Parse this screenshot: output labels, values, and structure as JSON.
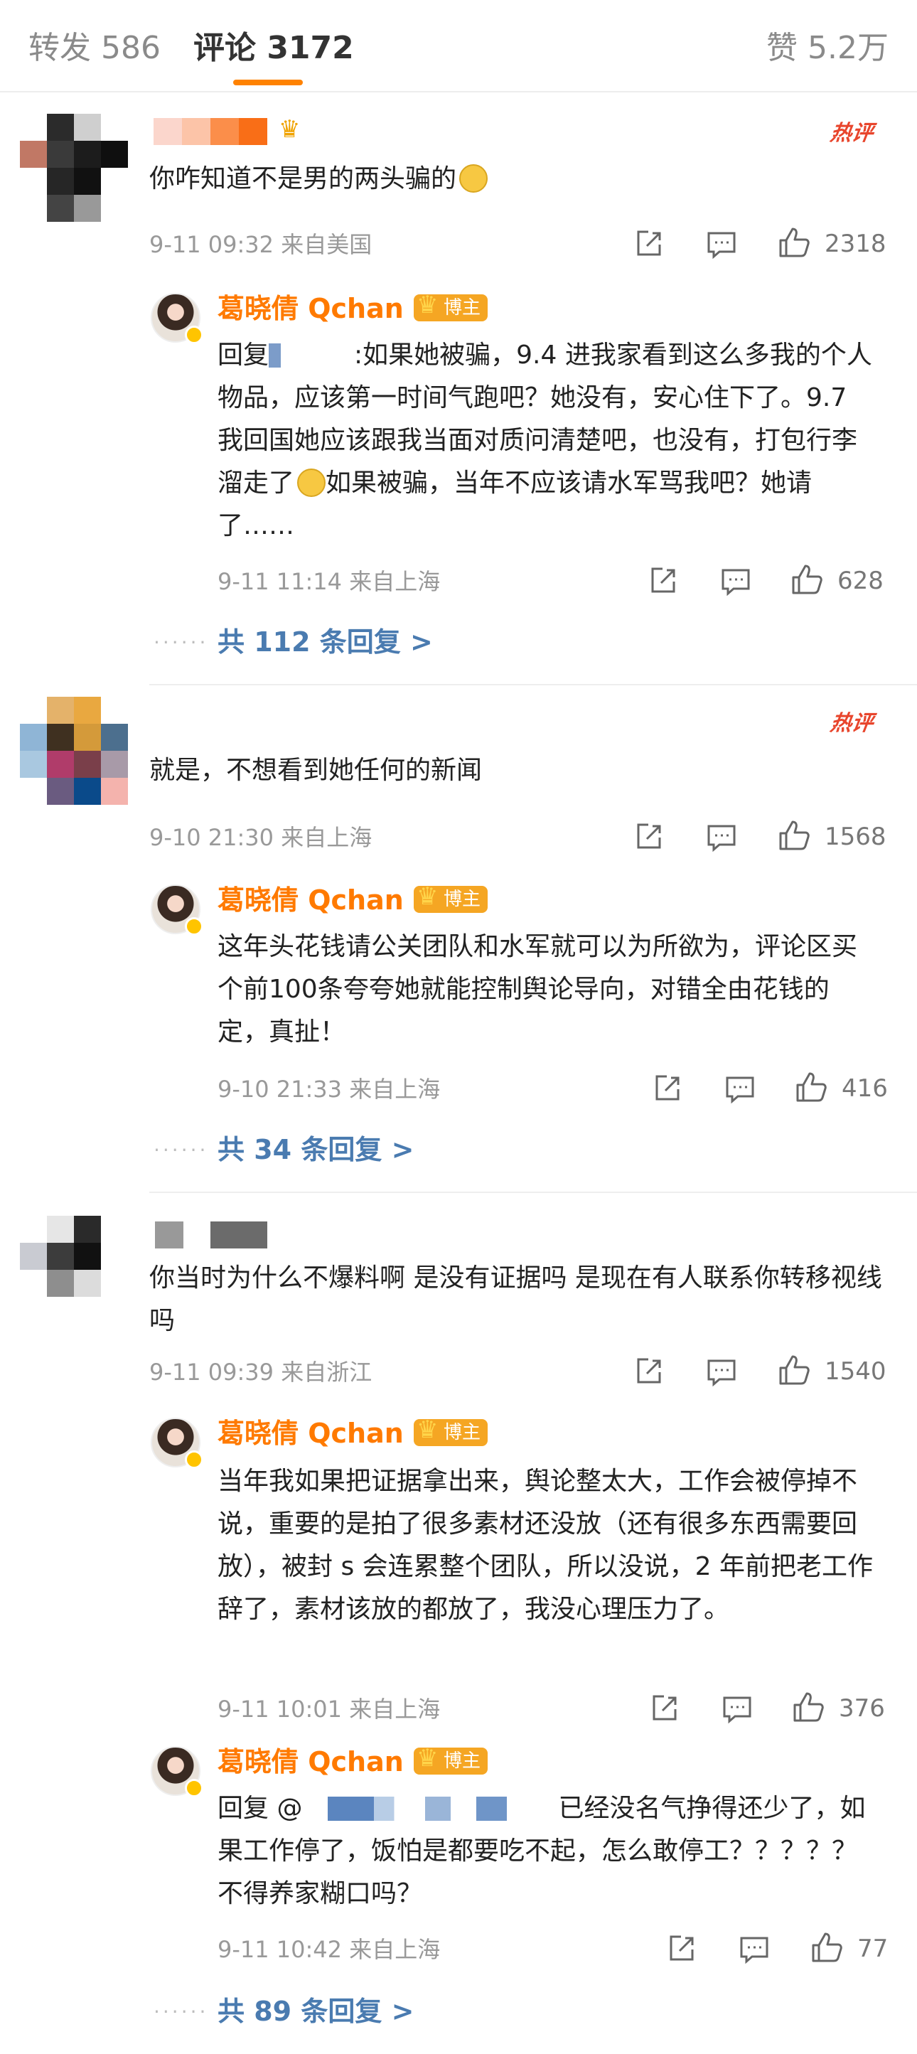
{
  "tabs": {
    "repost": "转发 586",
    "comment": "评论 3172",
    "like": "赞 5.2万"
  },
  "badge_hot": "热评",
  "verified": {
    "name": "葛晓倩 Qchan",
    "tag": "博主"
  },
  "comments": [
    {
      "text": "你咋知道不是男的两头骗的",
      "meta": "9-11 09:32  来自美国",
      "likes": "2318",
      "reply": {
        "text_prefix": "回复",
        "text": ":如果她被骗，9.4 进我家看到这么多我的个人物品，应该第一时间气跑吧？她没有，安心住下了。9.7 我回国她应该跟我当面对质问清楚吧，也没有，打包行李溜走了",
        "text_end": "如果被骗，当年不应该请水军骂我吧？她请了……",
        "meta": "9-11 11:14  来自上海",
        "likes": "628"
      },
      "more": "共 112 条回复 >"
    },
    {
      "text": "就是，不想看到她任何的新闻",
      "meta": "9-10 21:30  来自上海",
      "likes": "1568",
      "reply": {
        "text": "这年头花钱请公关团队和水军就可以为所欲为，评论区买个前100条夸夸她就能控制舆论导向，对错全由花钱的定，真扯！",
        "meta": "9-10 21:33  来自上海",
        "likes": "416"
      },
      "more": "共 34 条回复 >"
    },
    {
      "text": "你当时为什么不爆料啊 是没有证据吗  是现在有人联系你转移视线吗",
      "meta": "9-11 09:39  来自浙江",
      "likes": "1540",
      "reply": {
        "text": "当年我如果把证据拿出来，舆论整太大，工作会被停掉不说，重要的是拍了很多素材还没放（还有很多东西需要回放），被封 s 会连累整个团队，所以没说，2 年前把老工作辞了，素材该放的都放了，我没心理压力了。",
        "meta": "9-11 10:01  来自上海",
        "likes": "376"
      },
      "reply2": {
        "text_prefix": "回复 @",
        "text": "已经没名气挣得还少了，如果工作停了，饭怕是都要吃不起，怎么敢停工？？？？？不得养家糊口吗？",
        "meta": "9-11 10:42  来自上海",
        "likes": "77"
      },
      "more": "共 89 条回复 >"
    }
  ],
  "icons": [
    "repost-icon",
    "comment-icon",
    "like-icon",
    "crown-icon",
    "smiley-icon"
  ],
  "colors": {
    "accent": "#ff8200",
    "link": "#4a7bb0",
    "hot": "#e8452c",
    "verified_name": "#ff7a00"
  }
}
